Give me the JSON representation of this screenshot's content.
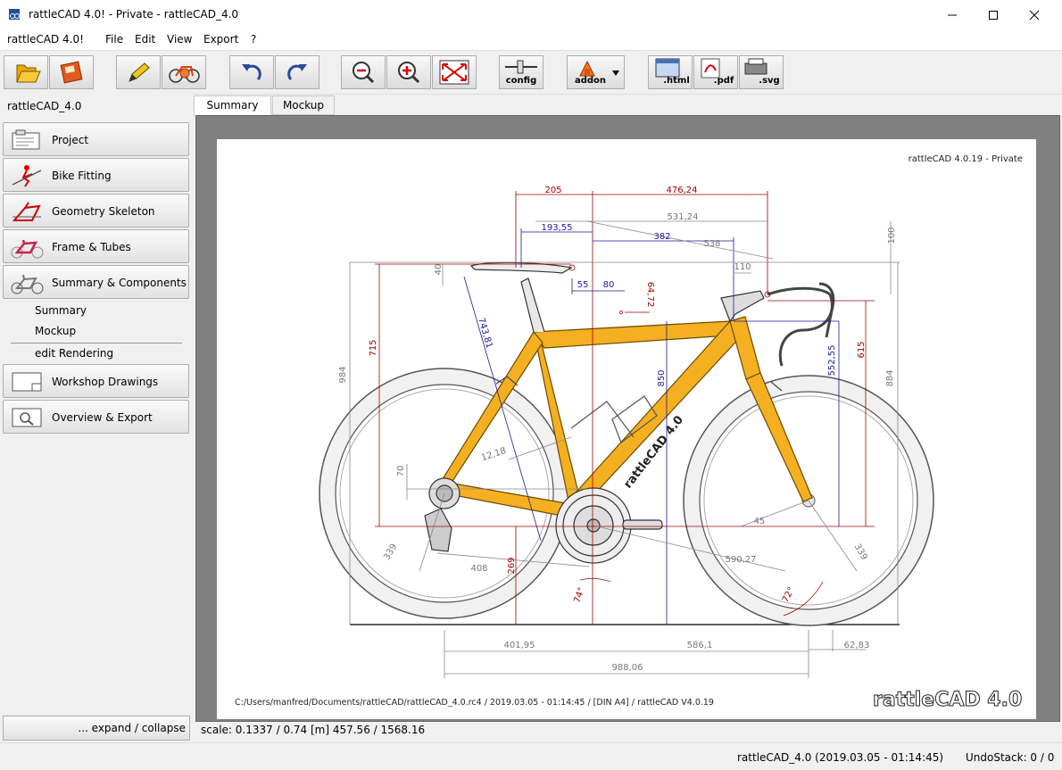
{
  "window": {
    "title": "rattleCAD 4.0! - Private  - rattleCAD_4.0"
  },
  "menubar": {
    "app_label": "rattleCAD 4.0!",
    "items": [
      "File",
      "Edit",
      "View",
      "Export",
      "?"
    ]
  },
  "toolbar": {
    "config_label": "config",
    "addon_label": "addon",
    "html_label": ".html",
    "pdf_label": ".pdf",
    "svg_label": ".svg"
  },
  "sidebar": {
    "project_name": "rattleCAD_4.0",
    "nav": [
      {
        "label": "Project",
        "icon": "project-icon"
      },
      {
        "label": "Bike Fitting",
        "icon": "bike-fitting-icon"
      },
      {
        "label": "Geometry Skeleton",
        "icon": "geometry-skeleton-icon"
      },
      {
        "label": "Frame & Tubes",
        "icon": "frame-tubes-icon"
      },
      {
        "label": "Summary & Components",
        "icon": "summary-components-icon"
      }
    ],
    "sub_items": [
      "Summary",
      "Mockup",
      "edit Rendering"
    ],
    "nav2": [
      {
        "label": "Workshop Drawings",
        "icon": "workshop-drawings-icon"
      },
      {
        "label": "Overview & Export",
        "icon": "overview-export-icon"
      }
    ],
    "expand_label": "... expand / collapse"
  },
  "tabs": [
    {
      "label": "Summary",
      "active": true
    },
    {
      "label": "Mockup",
      "active": false
    }
  ],
  "drawing": {
    "header": "rattleCAD  4.0.19  -  Private",
    "footer": "C:/Users/manfred/Documents/rattleCAD/rattleCAD_4.0.rc4   /   2019.03.05  -  01:14:45   /  [DIN A4]  /   rattleCAD    V4.0.19",
    "logo": "rattleCAD 4.0",
    "frame_decal": "rattleCAD 4.0",
    "dimensions": {
      "d205": "205",
      "d476": "476,24",
      "d531": "531,24",
      "d193": "193,55",
      "d382": "382",
      "d538": "538",
      "d100": "100",
      "d40": "40",
      "d110": "110",
      "d55": "55",
      "d80": "80",
      "d6472": "64,72",
      "d743": "743,81",
      "d715": "715",
      "d984": "984",
      "d850": "850",
      "d552": "552,55",
      "d615": "615",
      "d884": "884",
      "d1218": "12,18",
      "d70": "70",
      "d45": "45",
      "d339a": "339",
      "d339b": "339",
      "d408": "408",
      "d269": "269",
      "d590": "590,27",
      "d74": "74°",
      "d72": "72°",
      "d401": "401,95",
      "d586": "586,1",
      "d62": "62,83",
      "d988": "988,06"
    }
  },
  "status": {
    "scale": "scale: 0.1337 / 0.74  [m]  457.56 / 1568.16",
    "project": "rattleCAD_4.0 (2019.03.05 - 01:14:45)",
    "undo": "UndoStack:  0  /  0"
  },
  "colors": {
    "frame_yellow": "#f5b021",
    "dim_red": "#a30000",
    "dim_blue": "#1a1a9a",
    "dim_gray": "#888888"
  }
}
